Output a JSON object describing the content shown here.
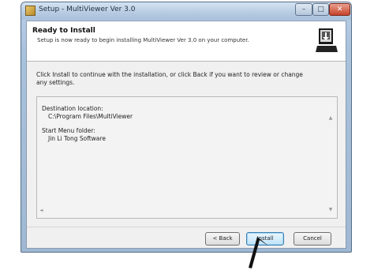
{
  "window": {
    "title": "Setup - MultiViewer Ver 3.0",
    "icon": "installer-icon",
    "controls": {
      "minimize": "–",
      "maximize": "□",
      "close": "✕"
    }
  },
  "header": {
    "title": "Ready to Install",
    "subtitle": "Setup is now ready to begin installing MultiViewer Ver 3.0 on your computer.",
    "logo": "computer-install-icon"
  },
  "content": {
    "intro": "Click Install to continue with the installation, or click Back if you want to review or change any settings.",
    "memo": {
      "destination_label": "Destination location:",
      "destination_value": "C:\\Program Files\\MultiViewer",
      "start_menu_label": "Start Menu folder:",
      "start_menu_value": "Jin Li Tong Software"
    }
  },
  "buttons": {
    "back": "< Back",
    "install": "Install",
    "cancel": "Cancel"
  },
  "colors": {
    "titlebar": "#b9cde3",
    "close_button": "#c6432a",
    "client_bg": "#f0f0f0",
    "install_button": "#bfe3f8"
  }
}
